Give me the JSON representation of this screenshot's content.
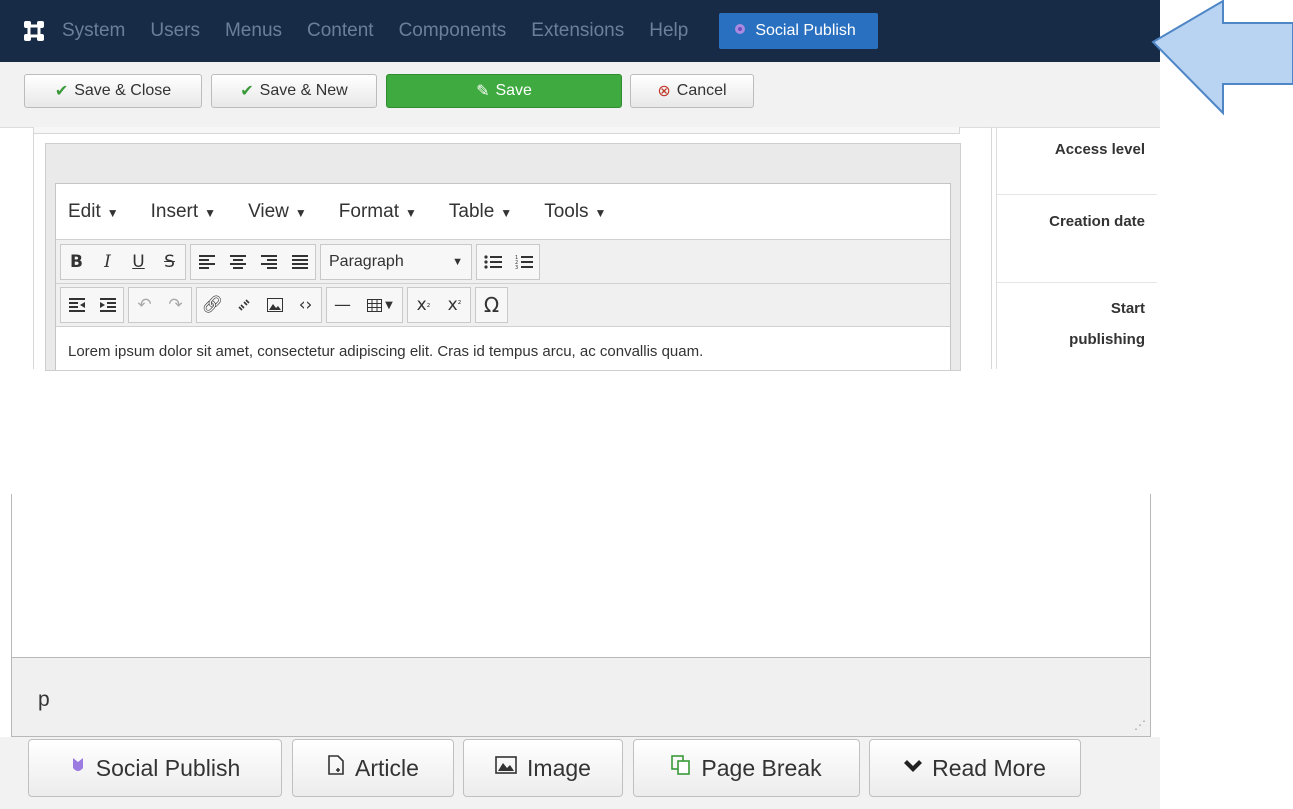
{
  "navbar": {
    "items": [
      "System",
      "Users",
      "Menus",
      "Content",
      "Components",
      "Extensions",
      "Help"
    ],
    "social_publish": "Social Publish"
  },
  "toolbar": {
    "save_close": "Save & Close",
    "save_new": "Save & New",
    "save": "Save",
    "cancel": "Cancel"
  },
  "editor": {
    "menus": [
      "Edit",
      "Insert",
      "View",
      "Format",
      "Table",
      "Tools"
    ],
    "block_format": "Paragraph",
    "content": "Lorem ipsum dolor sit amet, consectetur adipiscing elit. Cras id tempus arcu, ac convallis quam.",
    "status_path": "p"
  },
  "sidebar": {
    "access_level": "Access level",
    "creation_date": "Creation date",
    "start_publishing_1": "Start",
    "start_publishing_2": "publishing"
  },
  "bottom_buttons": {
    "social_publish": "Social Publish",
    "article": "Article",
    "image": "Image",
    "page_break": "Page Break",
    "read_more": "Read More"
  },
  "colors": {
    "navbar_bg": "#172b47",
    "nav_button": "#2a70c0",
    "save_green": "#3faa3f",
    "arrow_blue": "#b9d4f2"
  }
}
